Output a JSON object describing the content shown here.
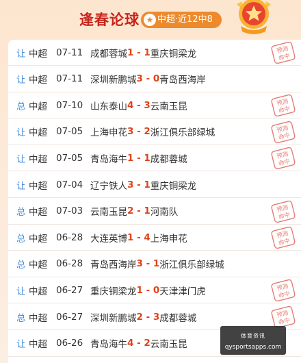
{
  "header": {
    "title": "逢春论球",
    "pill_label": "中超·近12中8",
    "pill_icon": "star-icon",
    "medal_icon": "medal-star-icon"
  },
  "stamp_text": "预测命中",
  "colors": {
    "accent_red": "#c9241c",
    "score_red": "#e0421a",
    "type_blue": "#4a90d9",
    "pill_orange": "#ec8a2c"
  },
  "rows": [
    {
      "type": "让",
      "league": "中超",
      "date": "07-11",
      "home": "成都蓉城",
      "score": "1 - 1",
      "away": "重庆铜梁龙",
      "hit": true
    },
    {
      "type": "让",
      "league": "中超",
      "date": "07-11",
      "home": "深圳新鹏城",
      "score": "3 - 0",
      "away": "青岛西海岸",
      "hit": false
    },
    {
      "type": "总",
      "league": "中超",
      "date": "07-10",
      "home": "山东泰山",
      "score": "4 - 3",
      "away": "云南玉昆",
      "hit": true
    },
    {
      "type": "让",
      "league": "中超",
      "date": "07-05",
      "home": "上海申花",
      "score": "3 - 2",
      "away": "浙江俱乐部绿城",
      "hit": true
    },
    {
      "type": "让",
      "league": "中超",
      "date": "07-05",
      "home": "青岛海牛",
      "score": "1 - 1",
      "away": "成都蓉城",
      "hit": true
    },
    {
      "type": "让",
      "league": "中超",
      "date": "07-04",
      "home": "辽宁铁人",
      "score": "3 - 1",
      "away": "重庆铜梁龙",
      "hit": false
    },
    {
      "type": "总",
      "league": "中超",
      "date": "07-03",
      "home": "云南玉昆",
      "score": "2 - 1",
      "away": "河南队",
      "hit": true
    },
    {
      "type": "总",
      "league": "中超",
      "date": "06-28",
      "home": "大连英博",
      "score": "1 - 4",
      "away": "上海申花",
      "hit": true
    },
    {
      "type": "总",
      "league": "中超",
      "date": "06-28",
      "home": "青岛西海岸",
      "score": "3 - 1",
      "away": "浙江俱乐部绿城",
      "hit": false
    },
    {
      "type": "让",
      "league": "中超",
      "date": "06-27",
      "home": "重庆铜梁龙",
      "score": "1 - 0",
      "away": "天津津门虎",
      "hit": true
    },
    {
      "type": "总",
      "league": "中超",
      "date": "06-27",
      "home": "深圳新鹏城",
      "score": "2 - 3",
      "away": "成都蓉城",
      "hit": true
    },
    {
      "type": "让",
      "league": "中超",
      "date": "06-26",
      "home": "青岛海牛",
      "score": "4 - 2",
      "away": "云南玉昆",
      "hit": false
    }
  ],
  "watermark": {
    "line1": "体育资讯",
    "line2": "qysportsapps.com"
  }
}
